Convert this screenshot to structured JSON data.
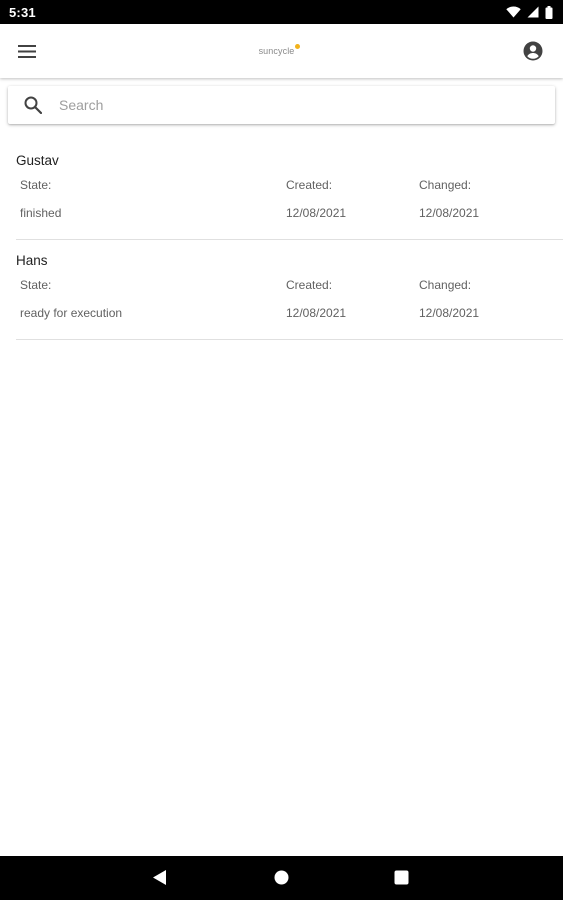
{
  "status_bar": {
    "time": "5:31",
    "icons": [
      "wifi-icon",
      "signal-icon",
      "battery-icon"
    ]
  },
  "app_bar": {
    "logo_text": "suncycle",
    "menu_icon": "hamburger-menu-icon",
    "account_icon": "account-circle-icon",
    "logo_accent": "#f2b21b"
  },
  "search": {
    "placeholder": "Search",
    "value": ""
  },
  "list": {
    "items": [
      {
        "name": "Gustav",
        "state_label": "State:",
        "created_label": "Created:",
        "changed_label": "Changed:",
        "state": "finished",
        "created": "12/08/2021",
        "changed": "12/08/2021"
      },
      {
        "name": "Hans",
        "state_label": "State:",
        "created_label": "Created:",
        "changed_label": "Changed:",
        "state": "ready for execution",
        "created": "12/08/2021",
        "changed": "12/08/2021"
      }
    ]
  },
  "nav_bar": {
    "icons": [
      "back-icon",
      "home-icon",
      "recents-icon"
    ]
  }
}
